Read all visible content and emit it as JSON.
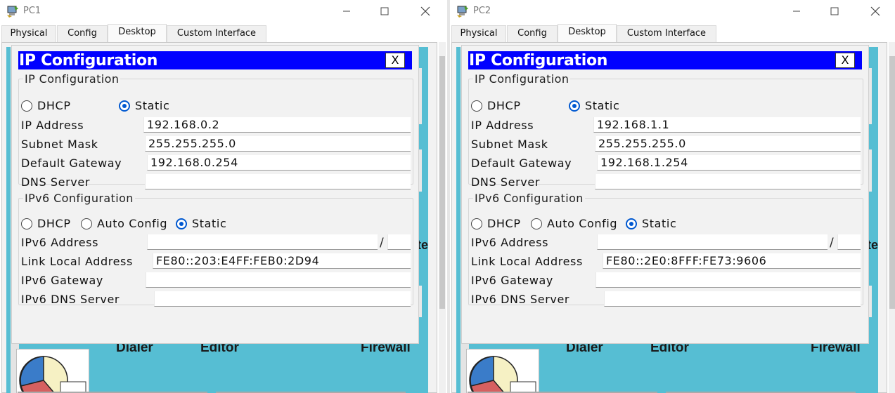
{
  "windows": [
    {
      "title": "PC1",
      "tabs": [
        "Physical",
        "Config",
        "Desktop",
        "Custom Interface"
      ],
      "active_tab": "Desktop",
      "dialog": {
        "title": "IP Configuration",
        "close_label": "X",
        "ipv4": {
          "legend": "IP Configuration",
          "dhcp_label": "DHCP",
          "static_label": "Static",
          "mode": "Static",
          "ip_label": "IP Address",
          "ip_value": "192.168.0.2",
          "mask_label": "Subnet Mask",
          "mask_value": "255.255.255.0",
          "gateway_label": "Default Gateway",
          "gateway_value": "192.168.0.254",
          "dns_label": "DNS Server",
          "dns_value": ""
        },
        "ipv6": {
          "legend": "IPv6 Configuration",
          "dhcp_label": "DHCP",
          "auto_label": "Auto Config",
          "static_label": "Static",
          "mode": "Static",
          "addr_label": "IPv6 Address",
          "addr_value": "",
          "prefix_sep": "/",
          "prefix_value": "",
          "link_local_label": "Link Local Address",
          "link_local_value": "FE80::203:E4FF:FEB0:2D94",
          "gateway_label": "IPv6 Gateway",
          "gateway_value": "",
          "dns_label": "IPv6 DNS Server",
          "dns_value": ""
        }
      },
      "background": {
        "dialer": "Dialer",
        "editor": "Editor",
        "firewall": "Firewall"
      }
    },
    {
      "title": "PC2",
      "tabs": [
        "Physical",
        "Config",
        "Desktop",
        "Custom Interface"
      ],
      "active_tab": "Desktop",
      "dialog": {
        "title": "IP Configuration",
        "close_label": "X",
        "ipv4": {
          "legend": "IP Configuration",
          "dhcp_label": "DHCP",
          "static_label": "Static",
          "mode": "Static",
          "ip_label": "IP Address",
          "ip_value": "192.168.1.1",
          "mask_label": "Subnet Mask",
          "mask_value": "255.255.255.0",
          "gateway_label": "Default Gateway",
          "gateway_value": "192.168.1.254",
          "dns_label": "DNS Server",
          "dns_value": ""
        },
        "ipv6": {
          "legend": "IPv6 Configuration",
          "dhcp_label": "DHCP",
          "auto_label": "Auto Config",
          "static_label": "Static",
          "mode": "Static",
          "addr_label": "IPv6 Address",
          "addr_value": "",
          "prefix_sep": "/",
          "prefix_value": "",
          "link_local_label": "Link Local Address",
          "link_local_value": "FE80::2E0:8FFF:FE73:9606",
          "gateway_label": "IPv6 Gateway",
          "gateway_value": "",
          "dns_label": "IPv6 DNS Server",
          "dns_value": ""
        }
      },
      "background": {
        "dialer": "Dialer",
        "editor": "Editor",
        "firewall": "Firewall"
      }
    }
  ],
  "colors": {
    "dialog_header": "#0000ff",
    "desktop_bg": "#56bed3",
    "radio_selected": "#0058d0"
  },
  "icons": [
    "packet-tracer-pc-icon",
    "minimize-icon",
    "maximize-icon",
    "close-icon",
    "pie-chart-app-icon"
  ]
}
